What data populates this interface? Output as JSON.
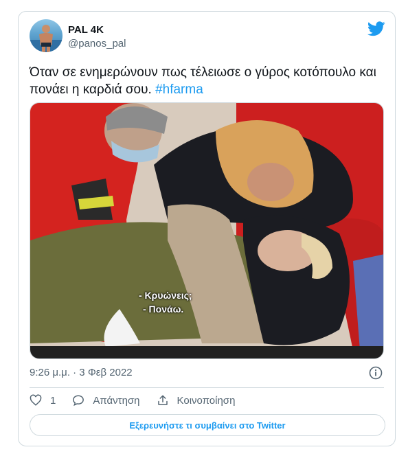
{
  "user": {
    "name": "PAL 4K",
    "handle": "@panos_pal"
  },
  "tweet": {
    "text": "Όταν σε ενημερώνουν πως τέλειωσε ο γύρος κοτόπουλο και πονάει η καρδιά σου.",
    "hashtag": "#hfarma",
    "timestamp": "9:26 μ.μ. · 3 Φεβ 2022"
  },
  "media": {
    "subtitle_line1": "- Κρυώνεις;",
    "subtitle_line2": "- Πονάω."
  },
  "actions": {
    "like_count": "1",
    "reply_label": "Απάντηση",
    "share_label": "Κοινοποίηση"
  },
  "footer": {
    "explore_label": "Εξερευνήστε τι συμβαίνει στο Twitter"
  },
  "colors": {
    "accent": "#1d9bf0",
    "text": "#0f1419",
    "secondary": "#536471",
    "border": "#cfd9de"
  }
}
